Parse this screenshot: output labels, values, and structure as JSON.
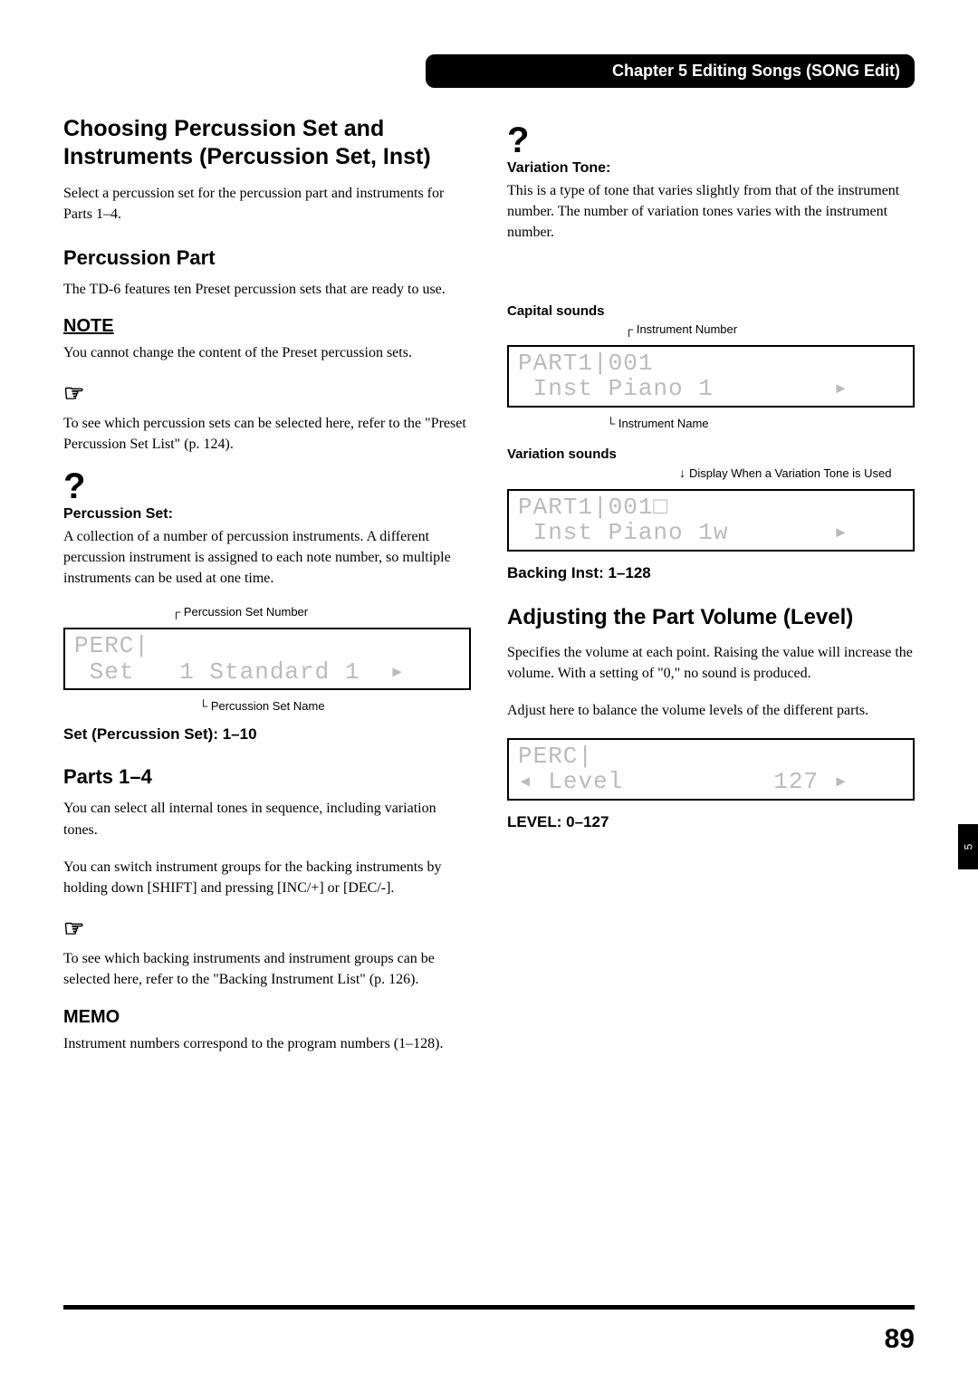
{
  "header": "Chapter 5 Editing Songs (SONG Edit)",
  "left": {
    "h_main": "Choosing Percussion Set and Instruments (Percussion Set, Inst)",
    "intro": "Select a percussion set for the percussion part and instruments for Parts 1–4.",
    "h_perc_part": "Percussion Part",
    "perc_part_body": "The TD-6 features ten Preset percussion sets that are ready to use.",
    "note_label": "NOTE",
    "note_body": "You cannot change the content of the Preset percussion sets.",
    "hand_glyph": "☞",
    "hand1_body": "To see which percussion sets can be selected here, refer to the \"Preset Percussion Set List\" (p. 124).",
    "q_glyph": "?",
    "percset_label": "Percussion Set:",
    "percset_body": "A collection of a number of percussion instruments. A different percussion instrument is assigned to each note number, so multiple instruments can be used at one time.",
    "annot_set_number": "Percussion Set Number",
    "lcd_set_line1": "PERC|",
    "lcd_set_line2": " Set   1 Standard 1  ▸",
    "annot_set_name": "Percussion Set Name",
    "setting_set": "Set (Percussion Set): 1–10",
    "h_parts": "Parts 1–4",
    "parts_body1": "You can select all internal tones in sequence, including variation tones.",
    "parts_body2": "You can switch instrument groups for the backing instruments by holding down [SHIFT] and pressing [INC/+] or [DEC/-].",
    "hand2_body": "To see which backing instruments and instrument groups can be selected here, refer to the \"Backing Instrument List\" (p. 126).",
    "memo_label": "MEMO",
    "memo_body": "Instrument numbers correspond to the program numbers (1–128)."
  },
  "right": {
    "vartone_label": "Variation Tone:",
    "vartone_body": "This is a type of tone that varies slightly from that of the instrument number. The number of variation tones varies with the instrument number.",
    "capital_heading": "Capital sounds",
    "annot_inst_number": "Instrument Number",
    "lcd_cap_line1": "PART1|001",
    "lcd_cap_line2": " Inst Piano 1        ▸",
    "annot_inst_name": "Instrument Name",
    "variation_heading": "Variation sounds",
    "annot_display_var": "Display When a Variation Tone is Used",
    "lcd_var_line1": "PART1|001□",
    "lcd_var_line2": " Inst Piano 1w       ▸",
    "setting_backing": "Backing Inst: 1–128",
    "h_level": "Adjusting the Part Volume (Level)",
    "level_body1": "Specifies the volume at each point. Raising the value will increase the volume. With a setting of \"0,\" no sound is produced.",
    "level_body2": "Adjust here to balance the volume levels of the different parts.",
    "lcd_level_line1": "PERC|",
    "lcd_level_line2": "◂ Level          127 ▸",
    "setting_level": "LEVEL: 0–127"
  },
  "page_number": "89",
  "side_tab": "5"
}
